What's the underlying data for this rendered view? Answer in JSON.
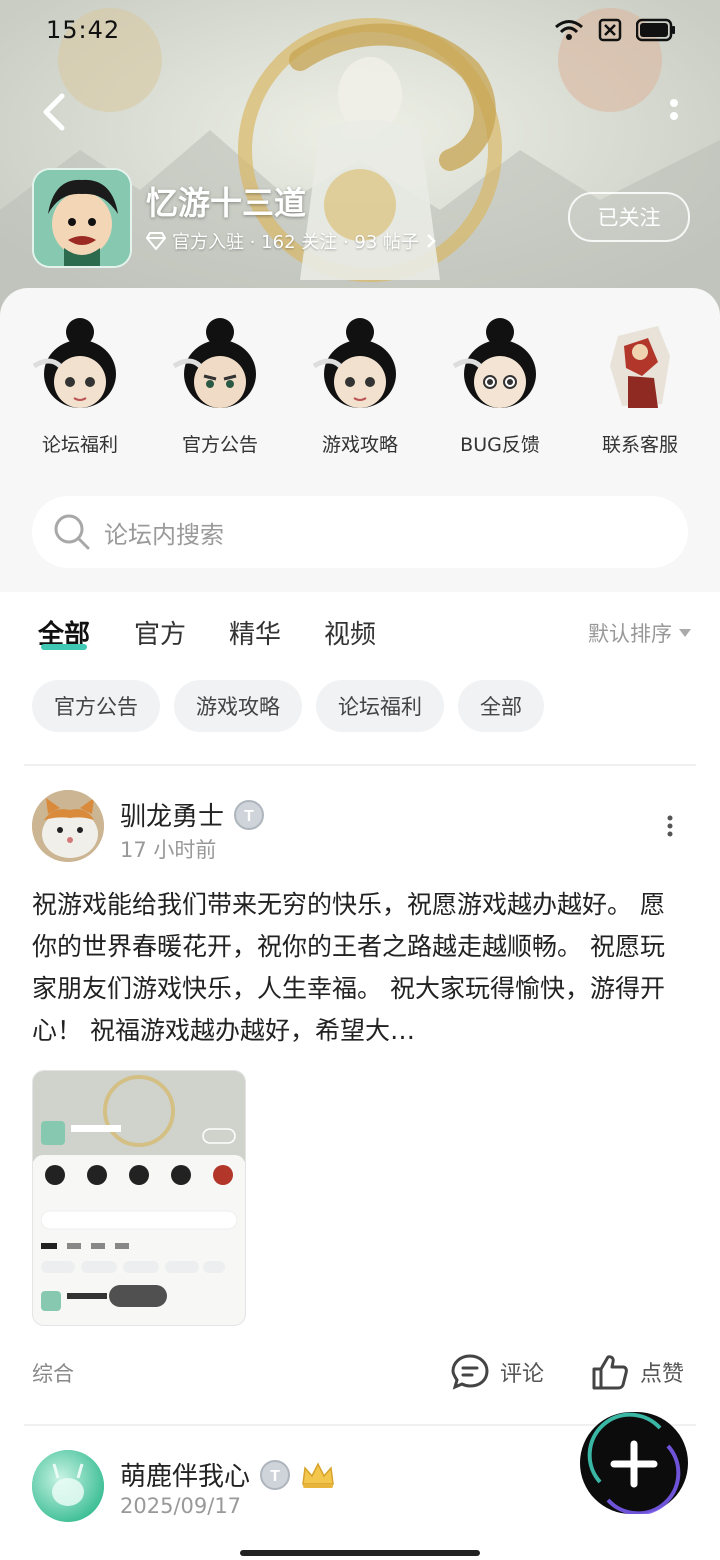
{
  "status_bar": {
    "time": "15:42"
  },
  "forum": {
    "title": "忆游十三道",
    "meta": "官方入驻 · 162 关注 · 93 帖子",
    "follow_label": "已关注"
  },
  "shortcuts": [
    {
      "label": "论坛福利"
    },
    {
      "label": "官方公告"
    },
    {
      "label": "游戏攻略"
    },
    {
      "label": "BUG反馈"
    },
    {
      "label": "联系客服"
    }
  ],
  "search": {
    "placeholder": "论坛内搜索"
  },
  "tabs": [
    {
      "label": "全部",
      "active": true
    },
    {
      "label": "官方",
      "active": false
    },
    {
      "label": "精华",
      "active": false
    },
    {
      "label": "视频",
      "active": false
    }
  ],
  "sort": {
    "label": "默认排序"
  },
  "chips": [
    {
      "label": "官方公告"
    },
    {
      "label": "游戏攻略"
    },
    {
      "label": "论坛福利"
    },
    {
      "label": "全部"
    }
  ],
  "posts": [
    {
      "author": "驯龙勇士",
      "time": "17 小时前",
      "body": "祝游戏能给我们带来无穷的快乐，祝愿游戏越办越好。 愿你的世界春暖花开，祝你的王者之路越走越顺畅。 祝愿玩家朋友们游戏快乐，人生幸福。 祝大家玩得愉快，游得开心！ 祝福游戏越办越好，希望大…",
      "category": "综合",
      "comment_label": "评论",
      "like_label": "点赞"
    },
    {
      "author": "萌鹿伴我心",
      "time": "2025/09/17"
    }
  ],
  "colors": {
    "accent": "#3fc9b5"
  }
}
